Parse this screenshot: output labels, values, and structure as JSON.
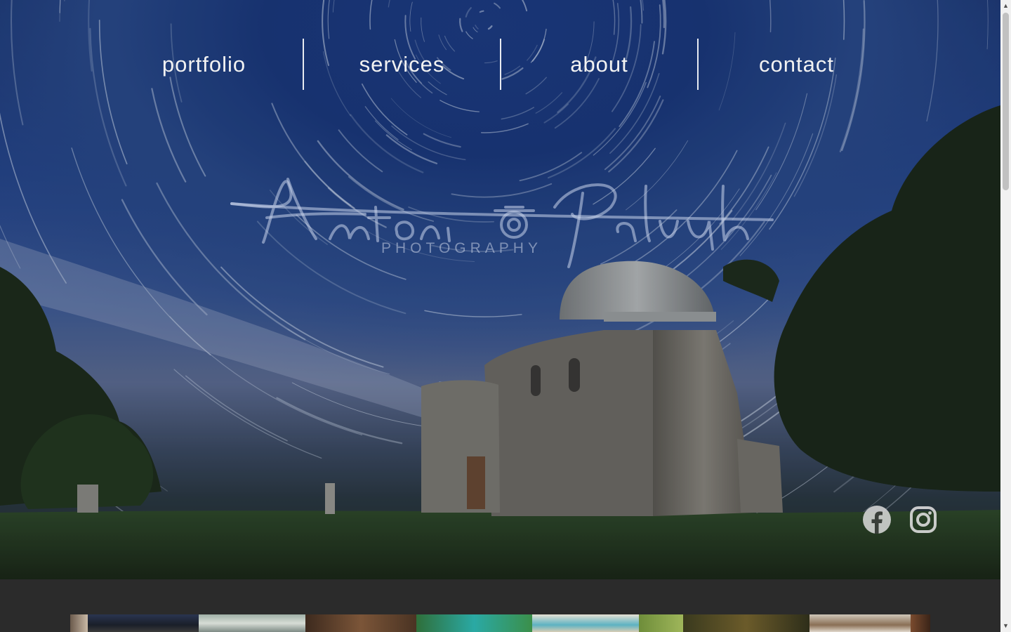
{
  "nav": {
    "items": [
      {
        "label": "portfolio"
      },
      {
        "label": "services"
      },
      {
        "label": "about"
      },
      {
        "label": "contact"
      }
    ]
  },
  "logo": {
    "script_text": "Antonio Paljuh",
    "subtitle": "PHOTOGRAPHY"
  },
  "social": {
    "facebook_icon": "facebook-icon",
    "instagram_icon": "instagram-icon"
  },
  "colors": {
    "nav_text": "#f2f2f2",
    "footer_bg": "#2b2b2b"
  }
}
